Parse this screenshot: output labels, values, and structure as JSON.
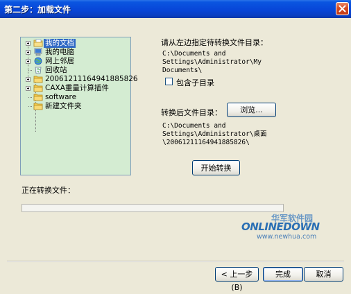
{
  "window": {
    "title": "第二步：加载文件"
  },
  "tree": {
    "items": [
      {
        "label": "我的文档",
        "icon": "my-documents-icon",
        "selected": true,
        "expandable": true
      },
      {
        "label": "我的电脑",
        "icon": "my-computer-icon",
        "selected": false,
        "expandable": true
      },
      {
        "label": "网上邻居",
        "icon": "network-icon",
        "selected": false,
        "expandable": true
      },
      {
        "label": "回收站",
        "icon": "recycle-bin-icon",
        "selected": false,
        "expandable": false
      },
      {
        "label": "20061211164941885826",
        "icon": "folder-icon",
        "selected": false,
        "expandable": true
      },
      {
        "label": "CAXA重量计算插件",
        "icon": "folder-icon",
        "selected": false,
        "expandable": true
      },
      {
        "label": "software",
        "icon": "folder-icon",
        "selected": false,
        "expandable": false
      },
      {
        "label": "新建文件夹",
        "icon": "folder-icon",
        "selected": false,
        "expandable": false
      }
    ]
  },
  "source": {
    "prompt": "请从左边指定待转换文件目录：",
    "path_lines": [
      "C:\\Documents and",
      "Settings\\Administrator\\My",
      "Documents\\"
    ],
    "include_subdirs_label": "包含子目录"
  },
  "target": {
    "label": "转换后文件目录：",
    "browse_label": "浏览...",
    "path_lines": [
      "C:\\Documents and",
      "Settings\\Administrator\\桌面",
      "\\20061211164941885826\\"
    ]
  },
  "actions": {
    "start_label": "开始转换",
    "back_label": "< 上一步(B)",
    "finish_label": "完成",
    "cancel_label": "取消"
  },
  "status": {
    "converting_label": "正在转换文件：",
    "progress": 0
  },
  "watermark": {
    "cn": "华军软件园",
    "logo": "ONLINEDOWN",
    "url": "www.newhua.com"
  },
  "colors": {
    "tree_bg": "#d4ecd2",
    "selection": "#316ac5",
    "titlebar": "#0846d8"
  }
}
